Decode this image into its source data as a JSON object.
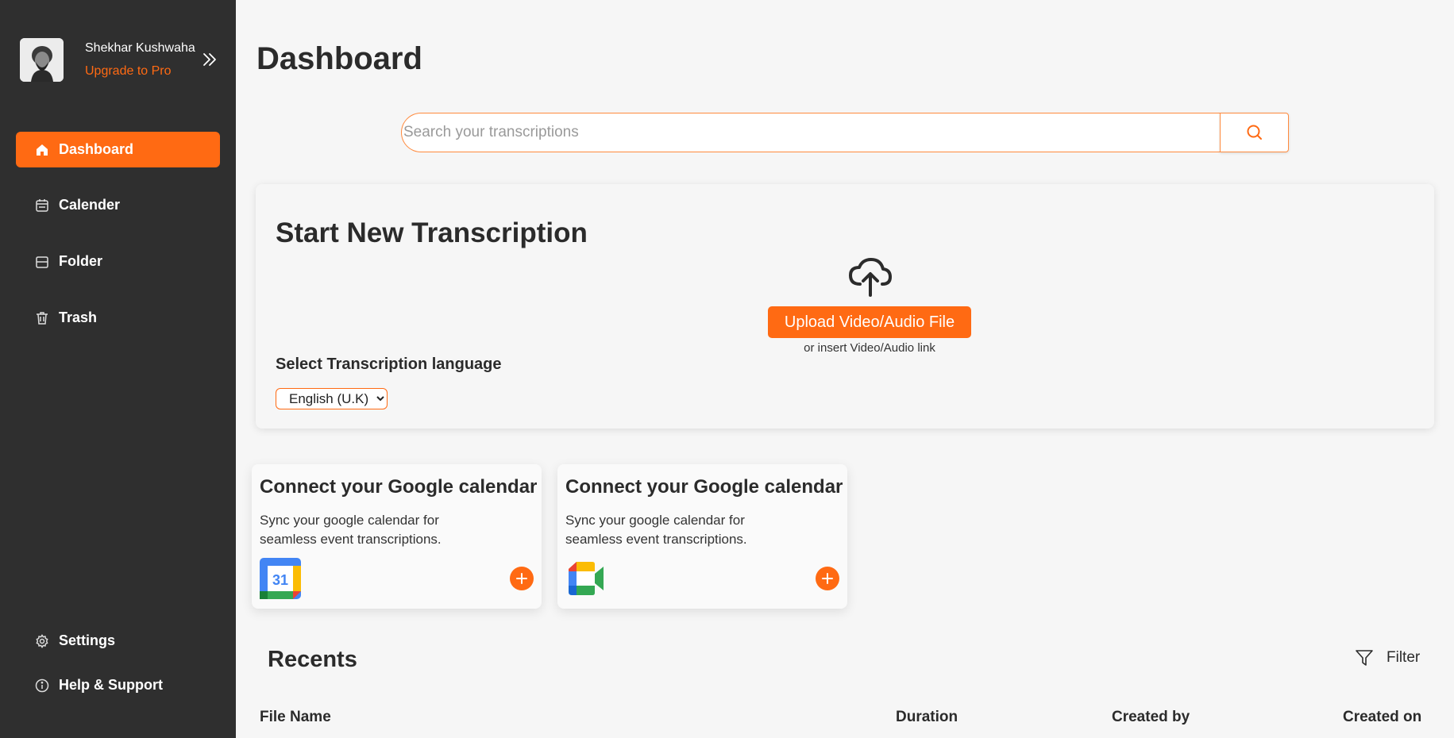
{
  "user": {
    "name": "Shekhar Kushwaha",
    "upgrade": "Upgrade to Pro"
  },
  "sidebar": {
    "items": [
      {
        "label": "Dashboard",
        "icon": "home-icon",
        "active": true
      },
      {
        "label": "Calender",
        "icon": "calendar-icon"
      },
      {
        "label": "Folder",
        "icon": "folder-icon"
      },
      {
        "label": "Trash",
        "icon": "trash-icon"
      }
    ],
    "bottom": [
      {
        "label": "Settings",
        "icon": "gear-icon"
      },
      {
        "label": "Help & Support",
        "icon": "info-icon"
      }
    ]
  },
  "page": {
    "title": "Dashboard"
  },
  "search": {
    "placeholder": "Search your transcriptions"
  },
  "transcription": {
    "title": "Start New Transcription",
    "upload_label": "Upload Video/Audio File",
    "upload_sub": "or insert Video/Audio link",
    "language_label": "Select Transcription language",
    "language_selected": "English (U.K)"
  },
  "integrations": [
    {
      "title": "Connect your Google calendar",
      "desc": "Sync your google calendar for seamless event transcriptions.",
      "logo": "google-calendar-icon"
    },
    {
      "title": "Connect your Google calendar",
      "desc": "Sync your google calendar for seamless event transcriptions.",
      "logo": "google-meet-icon"
    }
  ],
  "recents": {
    "title": "Recents",
    "filter_label": "Filter",
    "columns": [
      "File Name",
      "Duration",
      "Created by",
      "Created on"
    ]
  },
  "colors": {
    "accent": "#ff6a13",
    "sidebar_bg": "#2f2f2f",
    "page_bg": "#f6f6f6"
  }
}
